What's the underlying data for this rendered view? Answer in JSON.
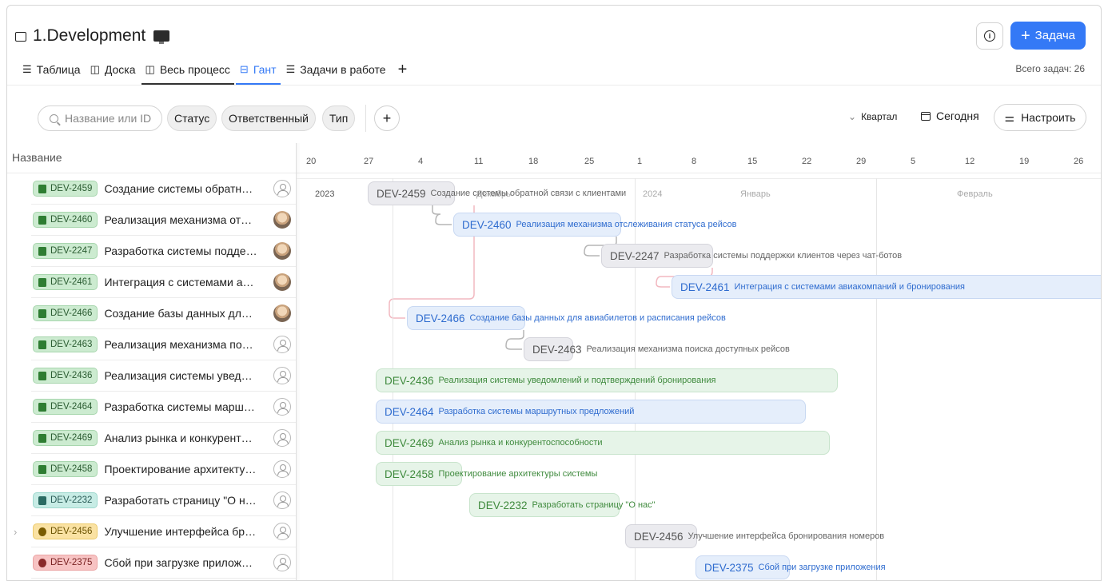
{
  "header": {
    "title": "1.Development",
    "add_task_label": "Задача",
    "total_tasks": "Всего задач: 26"
  },
  "tabs": [
    {
      "label": "Таблица",
      "icon": "list-icon"
    },
    {
      "label": "Доска",
      "icon": "board-icon"
    },
    {
      "label": "Весь процесс",
      "icon": "board-icon"
    },
    {
      "label": "Гант",
      "icon": "gantt-icon",
      "active": true
    },
    {
      "label": "Задачи в работе",
      "icon": "list-icon"
    }
  ],
  "filters": {
    "search_placeholder": "Название или ID",
    "chips": [
      "Статус",
      "Ответственный",
      "Тип"
    ],
    "scale_label": "Квартал",
    "today_label": "Сегодня",
    "configure_label": "Настроить"
  },
  "list": {
    "column_header": "Название",
    "rows": [
      {
        "id": "DEV-2459",
        "title": "Создание системы обратн…",
        "type": "green",
        "assignee": "empty"
      },
      {
        "id": "DEV-2460",
        "title": "Реализация механизма от…",
        "type": "green",
        "assignee": "photo"
      },
      {
        "id": "DEV-2247",
        "title": "Разработка системы подде…",
        "type": "green",
        "assignee": "photo"
      },
      {
        "id": "DEV-2461",
        "title": "Интеграция с системами а…",
        "type": "green",
        "assignee": "photo"
      },
      {
        "id": "DEV-2466",
        "title": "Создание базы данных дл…",
        "type": "green",
        "assignee": "photo"
      },
      {
        "id": "DEV-2463",
        "title": "Реализация механизма по…",
        "type": "green",
        "assignee": "empty"
      },
      {
        "id": "DEV-2436",
        "title": "Реализация системы увед…",
        "type": "green",
        "assignee": "empty"
      },
      {
        "id": "DEV-2464",
        "title": "Разработка системы марш…",
        "type": "green",
        "assignee": "empty"
      },
      {
        "id": "DEV-2469",
        "title": "Анализ рынка и конкурент…",
        "type": "green",
        "assignee": "empty"
      },
      {
        "id": "DEV-2458",
        "title": "Проектирование архитекту…",
        "type": "green",
        "assignee": "empty"
      },
      {
        "id": "DEV-2232",
        "title": "Разработать страницу \"О н…",
        "type": "teal",
        "assignee": "empty"
      },
      {
        "id": "DEV-2456",
        "title": "Улучшение интерфейса бр…",
        "type": "yellow",
        "assignee": "empty",
        "expandable": true
      },
      {
        "id": "DEV-2375",
        "title": "Сбой при загрузке прилож…",
        "type": "red",
        "assignee": "empty"
      }
    ]
  },
  "timeline": {
    "ticks": [
      "20",
      "27",
      "4",
      "11",
      "18",
      "25",
      "1",
      "8",
      "15",
      "22",
      "29",
      "5",
      "12",
      "19",
      "26"
    ],
    "periods": [
      "2023",
      "Декабрь",
      "2024",
      "Январь",
      "Февраль"
    ],
    "bars": [
      {
        "id": "DEV-2459",
        "text": "Создание системы обратной связи с клиентами",
        "color": "gray"
      },
      {
        "id": "DEV-2460",
        "text": "Реализация механизма отслеживания статуса рейсов",
        "color": "blue"
      },
      {
        "id": "DEV-2247",
        "text": "Разработка системы поддержки клиентов через чат-ботов",
        "color": "gray"
      },
      {
        "id": "DEV-2461",
        "text": "Интеграция с системами авиакомпаний и бронирования",
        "color": "blue"
      },
      {
        "id": "DEV-2466",
        "text": "Создание базы данных для авиабилетов и расписания рейсов",
        "color": "blue"
      },
      {
        "id": "DEV-2463",
        "text": "Реализация механизма поиска доступных рейсов",
        "color": "gray"
      },
      {
        "id": "DEV-2436",
        "text": "Реализация системы уведомлений и подтверждений бронирования",
        "color": "green"
      },
      {
        "id": "DEV-2464",
        "text": "Разработка системы маршрутных предложений",
        "color": "blue"
      },
      {
        "id": "DEV-2469",
        "text": "Анализ рынка и конкурентоспособности",
        "color": "green"
      },
      {
        "id": "DEV-2458",
        "text": "Проектирование архитектуры системы",
        "color": "green"
      },
      {
        "id": "DEV-2232",
        "text": "Разработать страницу \"О нас\"",
        "color": "green"
      },
      {
        "id": "DEV-2456",
        "text": "Улучшение интерфейса бронирования номеров",
        "color": "gray"
      },
      {
        "id": "DEV-2375",
        "text": "Сбой при загрузке приложения",
        "color": "blue"
      }
    ]
  },
  "colors": {
    "accent": "#3479f6",
    "link_gray": "#b5b5b5",
    "link_pink": "#f2b8c0"
  }
}
